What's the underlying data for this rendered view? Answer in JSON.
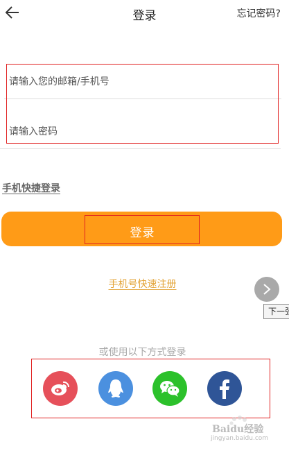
{
  "header": {
    "title": "登录",
    "forgot_password": "忘记密码?"
  },
  "form": {
    "account_placeholder": "请输入您的邮箱/手机号",
    "password_placeholder": "请输入密码",
    "quick_login_label": "手机快捷登录",
    "login_button_label": "登录",
    "register_link": "手机号快速注册"
  },
  "overlay": {
    "next_tooltip": "下一张"
  },
  "social_login": {
    "caption": "或使用以下方式登录",
    "providers": [
      {
        "name": "weibo",
        "icon": "weibo-icon",
        "color": "#e6505a"
      },
      {
        "name": "qq",
        "icon": "qq-icon",
        "color": "#4b90df"
      },
      {
        "name": "wechat",
        "icon": "wechat-icon",
        "color": "#2cc12b"
      },
      {
        "name": "facebook",
        "icon": "facebook-icon",
        "color": "#2f5597"
      }
    ]
  },
  "watermark": {
    "text": "Baidu经验",
    "sub": "jingyan.baidu.com"
  },
  "colors": {
    "accent_orange": "#ff9b17",
    "link_gold": "#e3a336",
    "highlight_red": "#e02020"
  }
}
